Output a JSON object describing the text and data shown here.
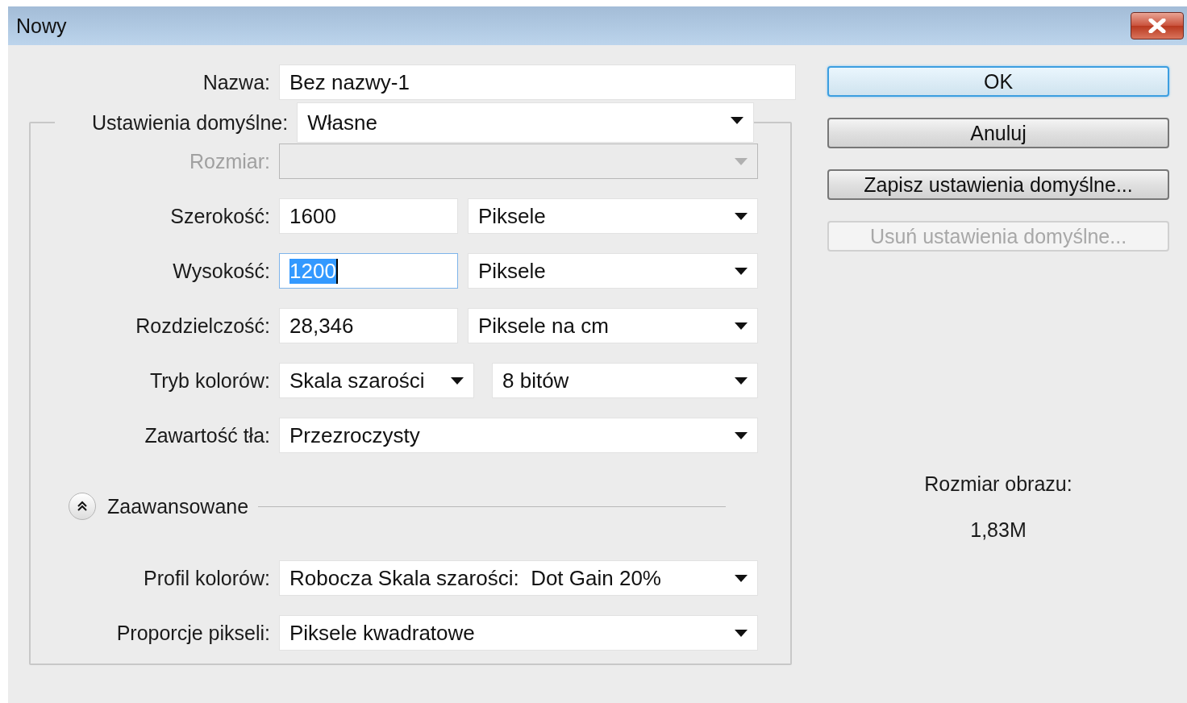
{
  "window": {
    "title": "Nowy"
  },
  "name": {
    "label": "Nazwa:",
    "value": "Bez nazwy-1"
  },
  "preset": {
    "label": "Ustawienia domyślne:",
    "value": "Własne"
  },
  "rows": [
    {
      "label": "Rozmiar:",
      "disabled": true,
      "controls": [
        {
          "kind": "select"
        }
      ]
    },
    {
      "label": "Szerokość:",
      "disabled": false,
      "controls": [
        {
          "kind": "input",
          "value": "1600",
          "highlighted": false
        },
        {
          "kind": "select",
          "value": "Piksele"
        }
      ]
    },
    {
      "label": "Wysokość:",
      "disabled": false,
      "controls": [
        {
          "kind": "input",
          "value": "1200",
          "highlighted": true
        },
        {
          "kind": "select",
          "value": "Piksele"
        }
      ]
    },
    {
      "label": "Rozdzielczość:",
      "disabled": false,
      "controls": [
        {
          "kind": "input",
          "value": "28,346",
          "highlighted": false
        },
        {
          "kind": "select",
          "value": "Piksele na cm"
        }
      ]
    },
    {
      "label": "Tryb kolorów:",
      "disabled": false,
      "controls": [
        {
          "kind": "select",
          "value": "Skala szarości"
        },
        {
          "kind": "select",
          "value": "8 bitów"
        }
      ]
    },
    {
      "label": "Zawartość tła:",
      "disabled": false,
      "controls": [
        {
          "kind": "select",
          "value": "Przezroczysty"
        }
      ]
    }
  ],
  "advanced": {
    "label": "Zaawansowane",
    "expanded": true
  },
  "advanced_rows": [
    {
      "label": "Profil kolorów:",
      "disabled": false,
      "controls": [
        {
          "kind": "select",
          "value": "Robocza Skala szarości:  Dot Gain 20%"
        }
      ]
    },
    {
      "label": "Proporcje pikseli:",
      "disabled": false,
      "controls": [
        {
          "kind": "select",
          "value": "Piksele kwadratowe"
        }
      ]
    }
  ],
  "buttons": [
    {
      "label": "OK",
      "default": true,
      "disabled": false
    },
    {
      "label": "Anuluj",
      "default": false,
      "disabled": false
    },
    {
      "label": "Zapisz ustawienia domyślne...",
      "default": false,
      "disabled": false
    },
    {
      "label": "Usuń ustawienia domyślne...",
      "default": false,
      "disabled": true
    }
  ],
  "image_size": {
    "label": "Rozmiar obrazu:",
    "value": "1,83M"
  }
}
